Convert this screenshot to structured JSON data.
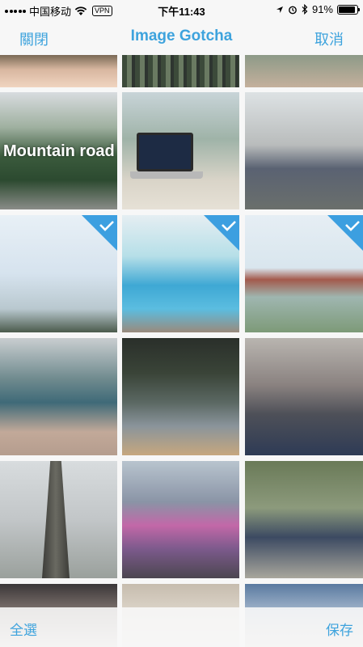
{
  "status_bar": {
    "carrier": "中国移动",
    "vpn": "VPN",
    "time": "下午11:43",
    "battery_percent": "91%",
    "battery_level": 0.91
  },
  "nav_bar": {
    "close_label": "關閉",
    "title": "Image Gotcha",
    "cancel_label": "取消"
  },
  "photos": [
    {
      "id": "face-partial",
      "selected": false
    },
    {
      "id": "market-stalls-top",
      "selected": false
    },
    {
      "id": "walkway-top",
      "selected": false
    },
    {
      "id": "mountain-road",
      "selected": false,
      "caption": "Mountain road"
    },
    {
      "id": "laptop-window",
      "selected": false
    },
    {
      "id": "bare-tree-sculpture",
      "selected": false
    },
    {
      "id": "flags-sky",
      "selected": true
    },
    {
      "id": "pool-slide",
      "selected": true
    },
    {
      "id": "china-pavilion",
      "selected": true
    },
    {
      "id": "pedestrian-bridge",
      "selected": false
    },
    {
      "id": "mirror-selfie",
      "selected": false
    },
    {
      "id": "man-phone-headphones",
      "selected": false
    },
    {
      "id": "skyscraper",
      "selected": false
    },
    {
      "id": "indoor-market",
      "selected": false
    },
    {
      "id": "man-blue-cap",
      "selected": false
    },
    {
      "id": "dusk-bottom",
      "selected": false
    },
    {
      "id": "blur-bottom",
      "selected": false
    },
    {
      "id": "building-bottom",
      "selected": false
    }
  ],
  "tool_bar": {
    "select_all_label": "全選",
    "save_label": "保存"
  },
  "colors": {
    "accent": "#3ea3dd",
    "checkmark": "#3c9fe0"
  },
  "icons": [
    "signal-icon",
    "wifi-icon",
    "location-icon",
    "alarm-icon",
    "bluetooth-icon",
    "battery-icon",
    "checkmark-icon"
  ]
}
